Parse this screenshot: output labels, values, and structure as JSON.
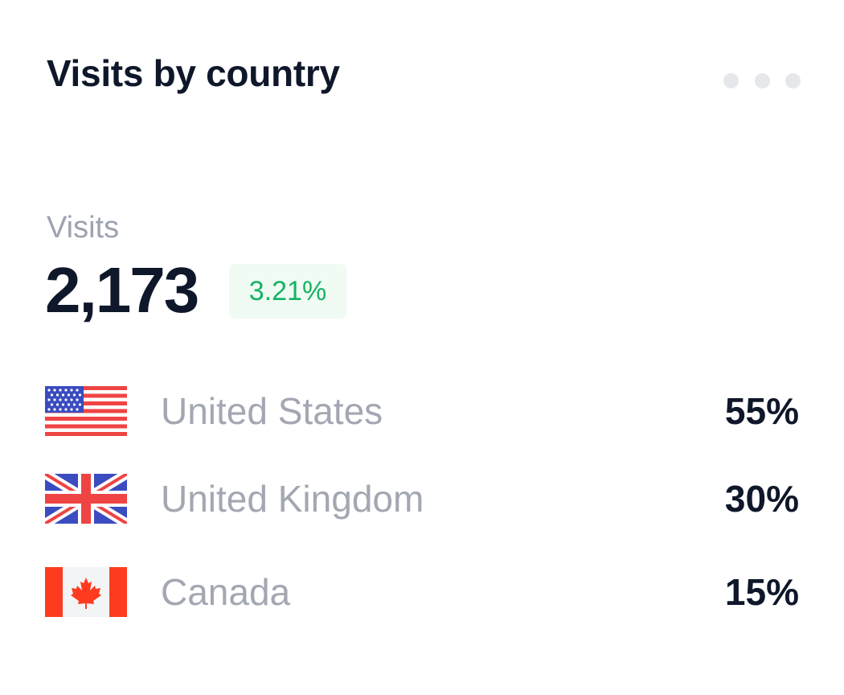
{
  "card": {
    "title": "Visits by country",
    "menu_icon": "more-horizontal-icon"
  },
  "summary": {
    "label": "Visits",
    "value": "2,173",
    "change": "3.21%",
    "change_color": "#16b364"
  },
  "countries": [
    {
      "name": "United States",
      "percent": "55%",
      "flag_icon": "us-flag-icon",
      "share": 55
    },
    {
      "name": "United Kingdom",
      "percent": "30%",
      "flag_icon": "uk-flag-icon",
      "share": 30
    },
    {
      "name": "Canada",
      "percent": "15%",
      "flag_icon": "canada-flag-icon",
      "share": 15
    }
  ],
  "colors": {
    "title": "#0f172a",
    "muted": "#9ca3af",
    "badge_bg": "#effbf3"
  }
}
